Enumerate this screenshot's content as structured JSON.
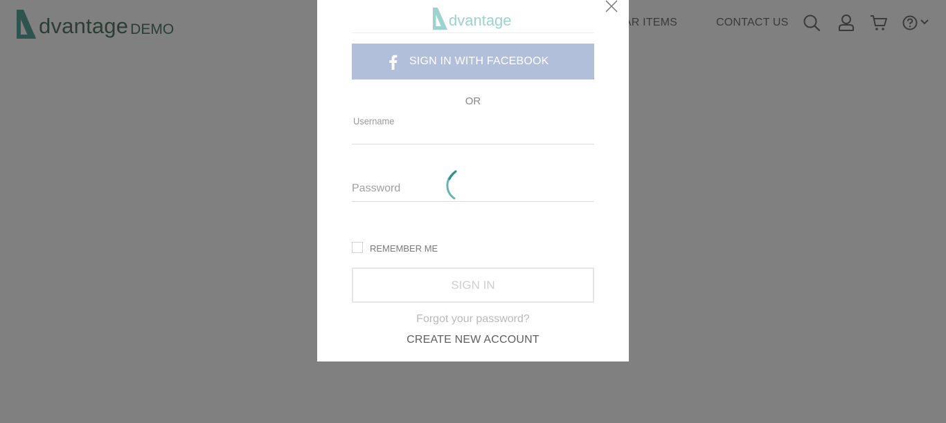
{
  "header": {
    "brand_name": "dvantage",
    "brand_suffix": "DEMO",
    "nav": {
      "popular_items": "ULAR ITEMS",
      "contact_us": "CONTACT US"
    },
    "icons": [
      "search-icon",
      "user-icon",
      "cart-icon",
      "help-icon",
      "chevron-down-icon"
    ]
  },
  "modal": {
    "logo_text": "dvantage",
    "facebook_label": "SIGN IN WITH FACEBOOK",
    "or_label": "OR",
    "username_label": "Username",
    "username_value": "",
    "password_label": "Password",
    "password_value": "",
    "remember_label": "REMEMBER ME",
    "remember_checked": false,
    "signin_label": "SIGN IN",
    "forgot_label": "Forgot your password?",
    "create_label": "CREATE NEW ACCOUNT",
    "icons": [
      "close-icon",
      "facebook-icon",
      "loading-spinner"
    ]
  },
  "colors": {
    "overlay": "#808080",
    "facebook": "#b2bfdb",
    "brand_teal": "#9dd3cf",
    "spinner_teal": "#4aa8a6"
  }
}
